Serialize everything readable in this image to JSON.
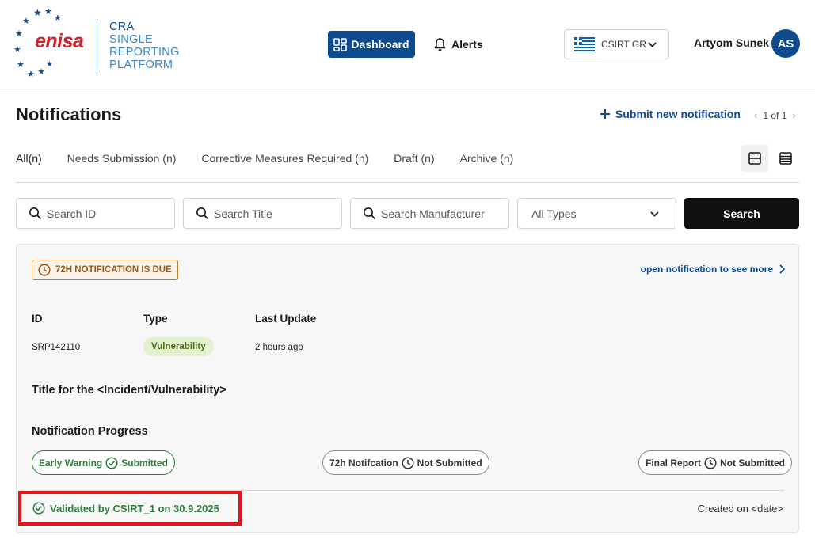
{
  "brand": {
    "logo_text": "enisa",
    "platform_lines": [
      "CRA",
      "SINGLE",
      "REPORTING",
      "PLATFORM"
    ],
    "accent_color": "#0e4a8e"
  },
  "nav": {
    "dashboard_label": "Dashboard",
    "alerts_label": "Alerts"
  },
  "csirt": {
    "selected": "CSIRT GR",
    "flag": "greece-flag"
  },
  "user": {
    "name": "Artyom Sunek",
    "initials": "AS"
  },
  "page": {
    "title": "Notifications",
    "submit_label": "Submit new notification",
    "pagination": "1 of 1"
  },
  "tabs": [
    {
      "label": "All(n)",
      "active": true
    },
    {
      "label": "Needs Submission (n)",
      "active": false
    },
    {
      "label": "Corrective Measures Required (n)",
      "active": false
    },
    {
      "label": "Draft (n)",
      "active": false
    },
    {
      "label": "Archive (n)",
      "active": false
    }
  ],
  "filters": {
    "search_id_placeholder": "Search ID",
    "search_title_placeholder": "Search Title",
    "search_manufacturer_placeholder": "Search Manufacturer",
    "type_selected": "All Types",
    "search_button": "Search"
  },
  "notification": {
    "due_badge": "72H NOTIFICATION IS DUE",
    "open_link": "open notification to see more",
    "columns": {
      "id": "ID",
      "type": "Type",
      "last_update": "Last Update"
    },
    "id": "SRP142110",
    "type": "Vulnerability",
    "last_update": "2 hours ago",
    "title": "Title for the <Incident/Vulnerability>",
    "progress_title": "Notification Progress",
    "steps": [
      {
        "name": "Early Warning",
        "status": "Submitted"
      },
      {
        "name": "72h Notifcation",
        "status": "Not Submitted"
      },
      {
        "name": "Final Report",
        "status": "Not Submitted"
      }
    ],
    "validated": "Validated by CSIRT_1 on 30.9.2025",
    "created": "Created on <date>"
  },
  "colors": {
    "success": "#2e7d3c",
    "warning": "#c07a2c",
    "highlight": "#e8141c"
  }
}
